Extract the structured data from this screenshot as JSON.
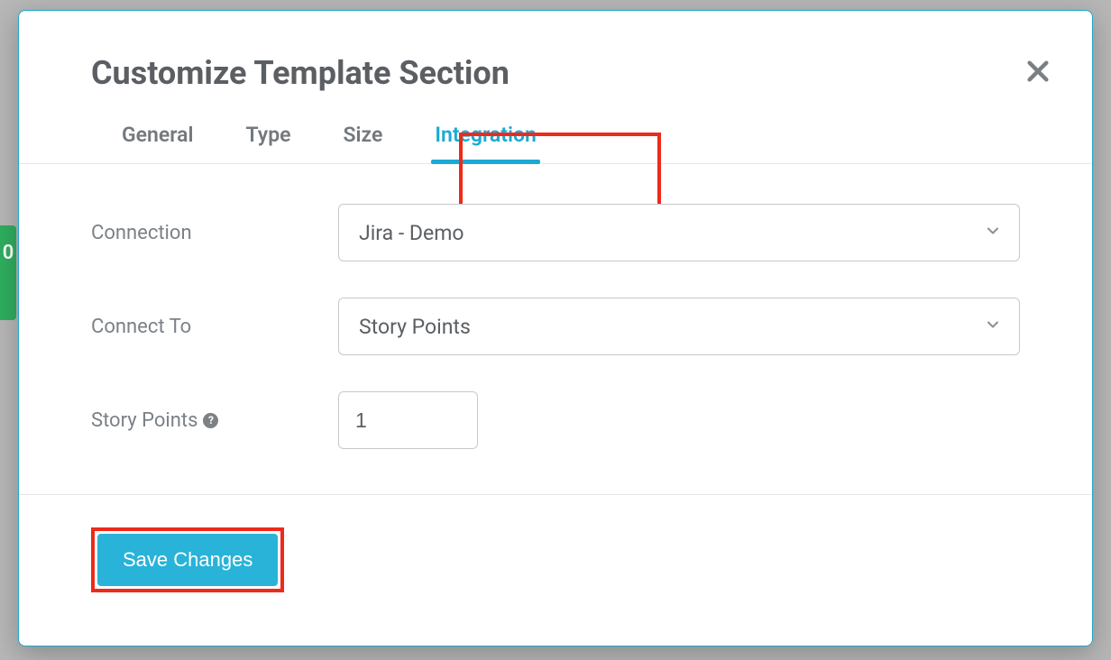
{
  "backdrop": {
    "partial_text": "0"
  },
  "modal": {
    "title": "Customize Template Section",
    "tabs": [
      {
        "label": "General",
        "active": false
      },
      {
        "label": "Type",
        "active": false
      },
      {
        "label": "Size",
        "active": false
      },
      {
        "label": "Integration",
        "active": true
      }
    ],
    "form": {
      "connection": {
        "label": "Connection",
        "value": "Jira - Demo"
      },
      "connect_to": {
        "label": "Connect To",
        "value": "Story Points"
      },
      "story_points": {
        "label": "Story Points",
        "value": "1"
      }
    },
    "footer": {
      "save_label": "Save Changes"
    }
  }
}
